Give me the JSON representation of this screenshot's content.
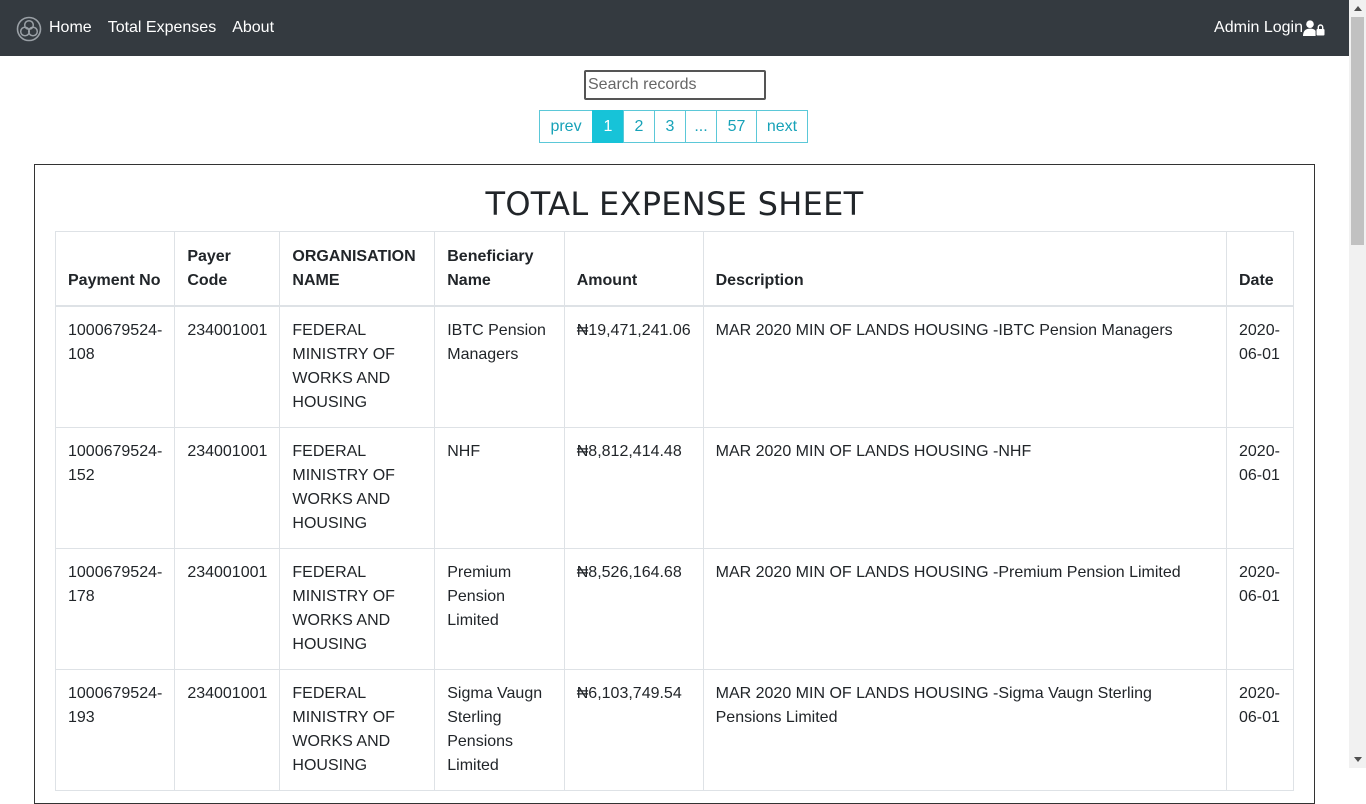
{
  "nav": {
    "links": [
      "Home",
      "Total Expenses",
      "About"
    ],
    "admin_label": "Admin Login"
  },
  "search": {
    "placeholder": "Search records"
  },
  "pagination": {
    "items": [
      "prev",
      "1",
      "2",
      "3",
      "...",
      "57",
      "next"
    ],
    "active": "1"
  },
  "sheet": {
    "title": "TOTAL EXPENSE SHEET",
    "headers": [
      "Payment No",
      "Payer Code",
      "ORGANISATION NAME",
      "Beneficiary Name",
      "Amount",
      "Description",
      "Date"
    ],
    "rows": [
      [
        "1000679524-108",
        "234001001",
        "FEDERAL MINISTRY OF WORKS AND HOUSING",
        "IBTC Pension Managers",
        "₦19,471,241.06",
        "MAR 2020 MIN OF LANDS HOUSING -IBTC Pension Managers",
        "2020-06-01"
      ],
      [
        "1000679524-152",
        "234001001",
        "FEDERAL MINISTRY OF WORKS AND HOUSING",
        "NHF",
        "₦8,812,414.48",
        "MAR 2020 MIN OF LANDS HOUSING -NHF",
        "2020-06-01"
      ],
      [
        "1000679524-178",
        "234001001",
        "FEDERAL MINISTRY OF WORKS AND HOUSING",
        "Premium Pension Limited",
        "₦8,526,164.68",
        "MAR 2020 MIN OF LANDS HOUSING -Premium Pension Limited",
        "2020-06-01"
      ],
      [
        "1000679524-193",
        "234001001",
        "FEDERAL MINISTRY OF WORKS AND HOUSING",
        "Sigma Vaugn Sterling Pensions Limited",
        "₦6,103,749.54",
        "MAR 2020 MIN OF LANDS HOUSING -Sigma Vaugn Sterling Pensions Limited",
        "2020-06-01"
      ]
    ]
  },
  "colors": {
    "navbar": "#343a40",
    "accent": "#17a2b8",
    "active_page": "#17c3d8"
  },
  "icons": {
    "logo": "trefoil-logo-icon",
    "admin": "user-lock-icon"
  }
}
